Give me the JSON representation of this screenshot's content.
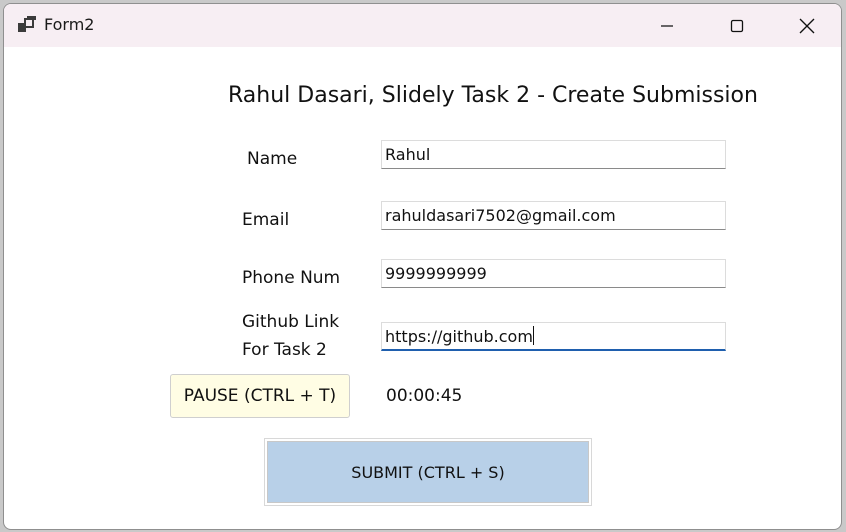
{
  "window": {
    "title": "Form2"
  },
  "form": {
    "heading": "Rahul Dasari, Slidely Task 2 - Create Submission",
    "name_label": "Name",
    "name_value": "Rahul",
    "email_label": "Email",
    "email_value": "rahuldasari7502@gmail.com",
    "phone_label": "Phone Num",
    "phone_value": "9999999999",
    "github_label_line1": "Github Link",
    "github_label_line2": "For Task 2",
    "github_value": "https://github.com"
  },
  "controls": {
    "pause_label": "PAUSE (CTRL + T)",
    "timer": "00:00:45",
    "submit_label": "SUBMIT (CTRL + S)"
  },
  "icons": {
    "app": "app-window-icon",
    "minimize": "minimize-icon",
    "maximize": "maximize-icon",
    "close": "close-icon"
  },
  "colors": {
    "titlebar_bg": "#f7eef3",
    "pause_bg": "#fffde4",
    "submit_bg": "#b8d0e8",
    "focus_underline": "#1f5fae"
  }
}
